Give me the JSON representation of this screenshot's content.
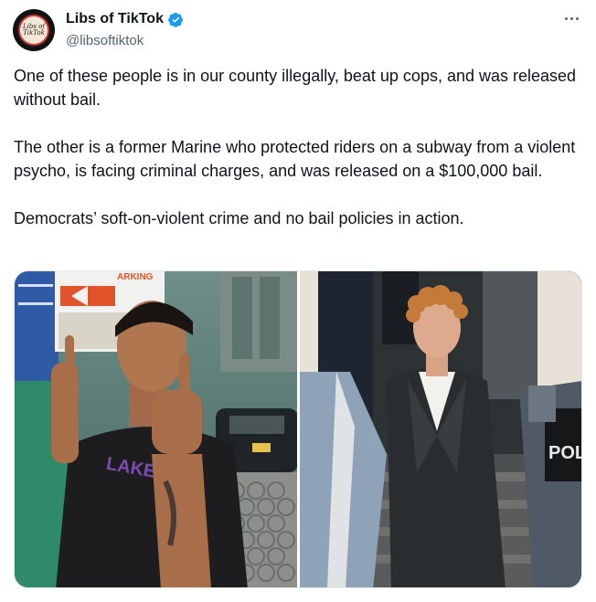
{
  "author": {
    "display_name": "Libs of TikTok",
    "handle": "@libsoftiktok",
    "avatar_text": "Libs of TikTok",
    "verified_icon": "verified-badge-icon",
    "verified_color": "#1d9bf0"
  },
  "menu": {
    "icon": "more-options-icon"
  },
  "tweet": {
    "paragraphs": [
      "One of these people is in our county illegally, beat up cops, and was released without bail.",
      "The other is a former Marine who protected riders on a subway from a violent psycho, is facing criminal charges, and was released on a $100,000 bail.",
      "Democrats’ soft-on-violent crime and no bail policies in action."
    ]
  },
  "media": {
    "left_photo_sign_text": "ARKING",
    "left_photo_shirt_text": "LAKERS",
    "right_photo_vest_text": "POL"
  }
}
